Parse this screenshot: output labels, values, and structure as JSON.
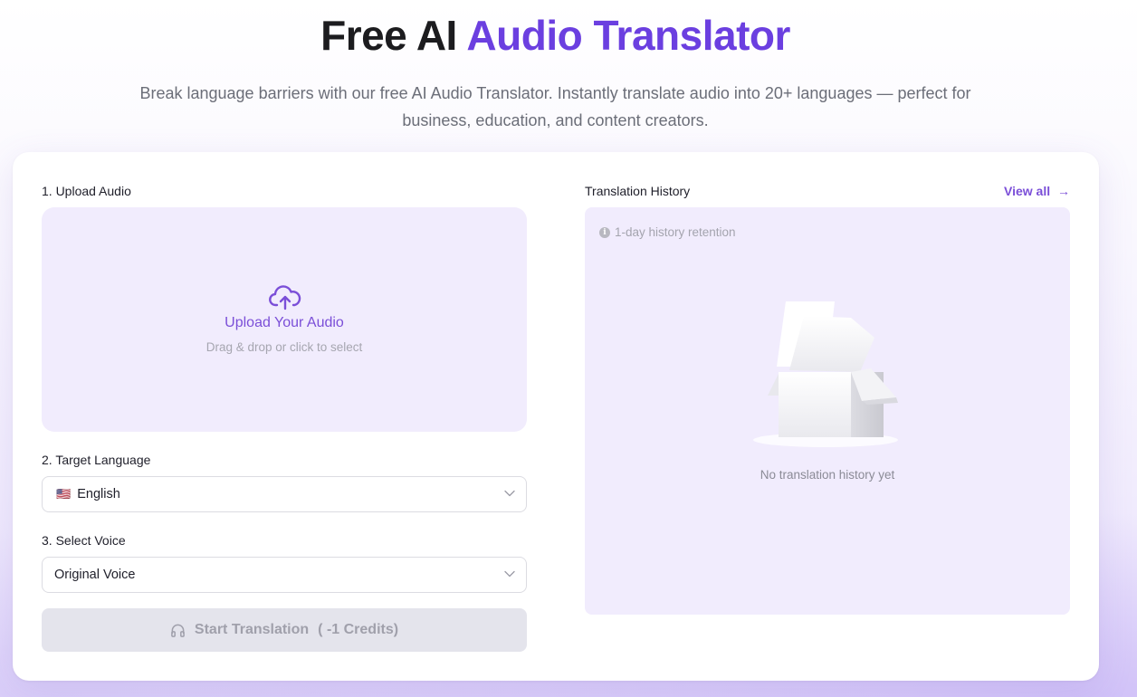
{
  "hero": {
    "title_plain": "Free AI",
    "title_accent": "Audio Translator",
    "subtitle": "Break language barriers with our free AI Audio Translator. Instantly translate audio into 20+ languages — perfect for business, education, and content creators."
  },
  "upload": {
    "step_label": "1. Upload Audio",
    "title": "Upload Your Audio",
    "hint": "Drag & drop or click to select",
    "icon": "cloud-upload-icon"
  },
  "language": {
    "step_label": "2. Target Language",
    "flag": "🇺🇸",
    "selected": "English"
  },
  "voice": {
    "step_label": "3. Select Voice",
    "selected": "Original Voice"
  },
  "start_button": {
    "label": "Start Translation",
    "credits": "( -1 Credits)",
    "icon": "headphones-icon",
    "disabled": true
  },
  "history": {
    "title": "Translation History",
    "view_all": "View all",
    "view_all_arrow": "→",
    "retention": "1-day history retention",
    "empty": "No translation history yet"
  },
  "colors": {
    "accent": "#6b3fe0",
    "panel_bg": "#f1ecfd",
    "button_disabled": "#e4e4ec"
  }
}
